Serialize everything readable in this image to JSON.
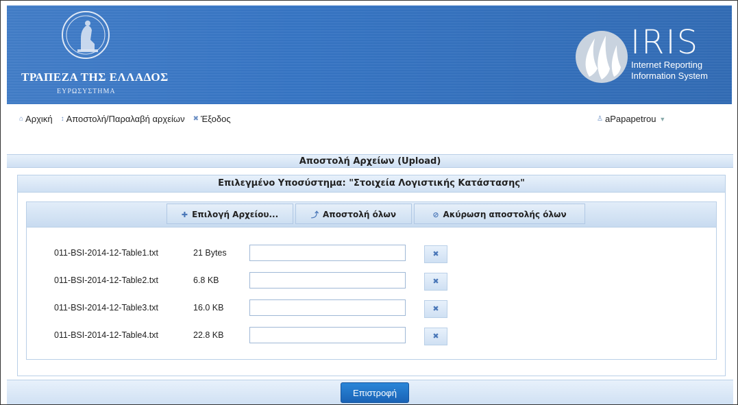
{
  "header": {
    "bank_name": "ΤΡΑΠΕΖΑ ΤΗΣ ΕΛΛΑΔΟΣ",
    "bank_subtitle": "ΕΥΡΩΣΥΣΤΗΜΑ",
    "app_title": "IRIS",
    "app_subtitle_line1": "Internet Reporting",
    "app_subtitle_line2": "Information System"
  },
  "nav": {
    "home": "Αρχική",
    "upload_download": "Αποστολή/Παραλαβή αρχείων",
    "logout": "Έξοδος",
    "user": "aPapapetrou"
  },
  "page": {
    "title": "Αποστολή Αρχείων (Upload)",
    "subsystem_label": "Επιλεγμένο Υποσύστημα: \"Στοιχεία Λογιστικής Κατάστασης\""
  },
  "toolbar": {
    "choose_file": "Επιλογή Αρχείου...",
    "upload_all": "Αποστολή όλων",
    "cancel_all": "Ακύρωση αποστολής όλων"
  },
  "files": [
    {
      "name": "011-BSI-2014-12-Table1.txt",
      "size": "21 Bytes",
      "progress": 0
    },
    {
      "name": "011-BSI-2014-12-Table2.txt",
      "size": "6.8 KB",
      "progress": 0
    },
    {
      "name": "011-BSI-2014-12-Table3.txt",
      "size": "16.0 KB",
      "progress": 0
    },
    {
      "name": "011-BSI-2014-12-Table4.txt",
      "size": "22.8 KB",
      "progress": 0
    }
  ],
  "footer": {
    "back_button": "Επιστροφή"
  },
  "colors": {
    "banner": "#3a77c4",
    "accent": "#1a63b6",
    "panel": "#d7e6f6"
  }
}
